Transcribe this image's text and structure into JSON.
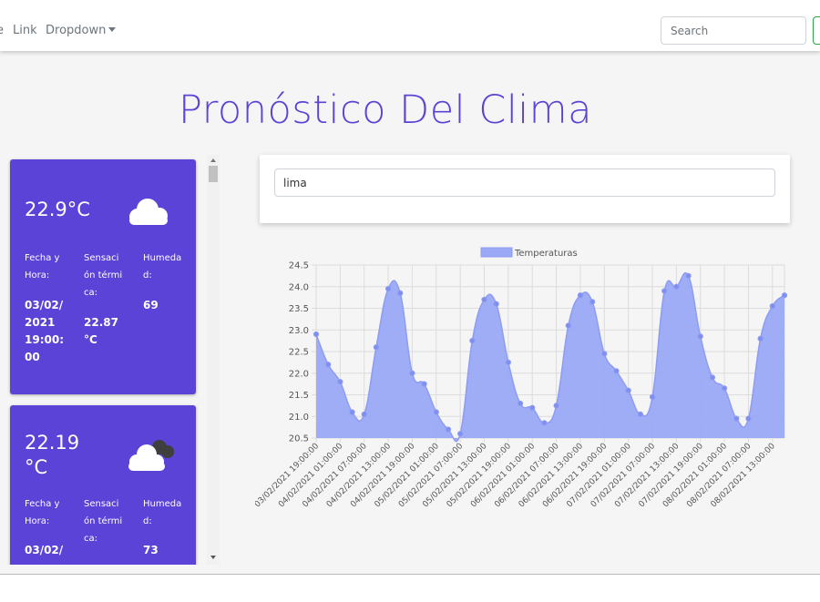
{
  "navbar": {
    "partial_item": "e",
    "link_label": "Link",
    "dropdown_label": "Dropdown",
    "search_placeholder": "Search"
  },
  "page": {
    "title": "Pronóstico Del Clima"
  },
  "search_card": {
    "city_value": "lima"
  },
  "cards": [
    {
      "temp": "22.9°C",
      "icon": "cloud-icon",
      "label_datetime": "Fecha y Hora:",
      "value_datetime": "03/02/ 2021 19:00: 00",
      "label_feels": "Sensación térmica:",
      "value_feels": "22.87 °C",
      "label_humidity": "Humedad:",
      "value_humidity": "69"
    },
    {
      "temp": "22.19 °C",
      "icon": "partly-cloudy-icon",
      "label_datetime": "Fecha y Hora:",
      "value_datetime": "03/02/",
      "label_feels": "Sensación térmica:",
      "label_humidity": "Humedad:",
      "value_humidity": "73"
    }
  ],
  "colors": {
    "accent": "#5a43d6",
    "chart_fill": "#9aa8f5",
    "chart_point": "#7f8ff0"
  },
  "chart_data": {
    "type": "area",
    "legend": [
      "Temperaturas"
    ],
    "legend_position": "top",
    "grid": true,
    "ylim": [
      20.5,
      24.5
    ],
    "yticks": [
      20.5,
      21.0,
      21.5,
      22.0,
      22.5,
      23.0,
      23.5,
      24.0,
      24.5
    ],
    "xtick_labels": [
      "03/02/2021 19:00:00",
      "04/02/2021 01:00:00",
      "04/02/2021 07:00:00",
      "04/02/2021 13:00:00",
      "04/02/2021 19:00:00",
      "05/02/2021 01:00:00",
      "05/02/2021 07:00:00",
      "05/02/2021 13:00:00",
      "05/02/2021 19:00:00",
      "06/02/2021 01:00:00",
      "06/02/2021 07:00:00",
      "06/02/2021 13:00:00",
      "06/02/2021 19:00:00",
      "07/02/2021 01:00:00",
      "07/02/2021 07:00:00",
      "07/02/2021 13:00:00",
      "07/02/2021 19:00:00",
      "08/02/2021 01:00:00",
      "08/02/2021 07:00:00",
      "08/02/2021 13:00:00"
    ],
    "series": [
      {
        "name": "Temperaturas",
        "values": [
          22.9,
          22.2,
          21.8,
          21.1,
          21.05,
          22.6,
          23.95,
          23.85,
          22.0,
          21.75,
          21.1,
          20.7,
          20.6,
          22.75,
          23.7,
          23.6,
          22.25,
          21.3,
          21.2,
          20.85,
          21.25,
          23.1,
          23.8,
          23.65,
          22.45,
          22.05,
          21.6,
          21.05,
          21.45,
          23.9,
          24.0,
          24.25,
          22.85,
          21.9,
          21.65,
          20.95,
          20.95,
          22.8,
          23.55,
          23.8
        ]
      }
    ]
  }
}
